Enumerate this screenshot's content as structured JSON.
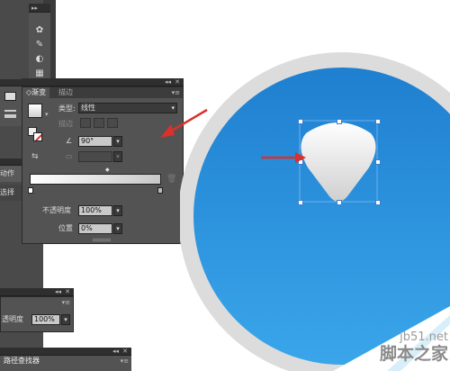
{
  "gradient_panel": {
    "tabs": [
      "渐变",
      "描边"
    ],
    "type_label": "类型:",
    "type_value": "线性",
    "stroke_label": "描边",
    "angle_value": "90°",
    "opacity_label": "不透明度",
    "opacity_value": "100%",
    "position_label": "位置",
    "position_value": "0%"
  },
  "left_tabs": {
    "actions": "动作",
    "select": "选择"
  },
  "transparency_panel": {
    "opacity_label": "透明度",
    "opacity_value": "100%"
  },
  "pathfinder_panel": {
    "title": "路径查找器"
  },
  "tools": [
    "symbol-sprayer-icon",
    "eyedropper-icon",
    "blend-icon",
    "perspective-icon"
  ],
  "watermark": {
    "site": "jb51.net",
    "name": "脚本之家"
  },
  "colors": {
    "circle_top": "#1f7fd0",
    "circle_bottom": "#3aa6ea",
    "ring": "#dcdcdc",
    "arrow": "#d9312b",
    "panel": "#535353"
  }
}
